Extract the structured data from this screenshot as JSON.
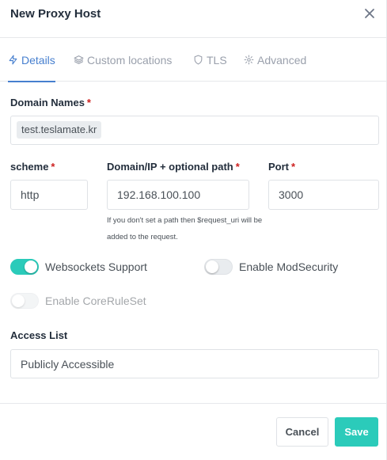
{
  "modal": {
    "title": "New Proxy Host",
    "close_icon": "close-icon"
  },
  "tabs": [
    {
      "label": "Details",
      "icon": "bolt-icon",
      "active": true
    },
    {
      "label": "Custom locations",
      "icon": "layers-icon",
      "active": false
    },
    {
      "label": "TLS",
      "icon": "shield-icon",
      "active": false
    },
    {
      "label": "Advanced",
      "icon": "gear-icon",
      "active": false
    }
  ],
  "form": {
    "domain_names": {
      "label": "Domain Names",
      "required": "*",
      "chips": [
        "test.teslamate.kr"
      ]
    },
    "scheme": {
      "label": "scheme",
      "required": "*",
      "value": "http"
    },
    "forward_host": {
      "label": "Domain/IP + optional path",
      "required": "*",
      "value": "192.168.100.100",
      "help_line1": "If you don't set a path then $request_uri will be",
      "help_line2": "added to the request."
    },
    "port": {
      "label": "Port",
      "required": "*",
      "value": "3000"
    },
    "toggles": {
      "websockets": {
        "label": "Websockets Support",
        "on": true
      },
      "modsecurity": {
        "label": "Enable ModSecurity",
        "on": false
      },
      "coreruleset": {
        "label": "Enable CoreRuleSet",
        "on": false,
        "disabled": true
      }
    },
    "access_list": {
      "label": "Access List",
      "value": "Publicly Accessible"
    }
  },
  "footer": {
    "cancel_label": "Cancel",
    "save_label": "Save"
  },
  "colors": {
    "accent": "#2bcbba",
    "tab_active": "#467fcf",
    "required": "#cd201f"
  }
}
